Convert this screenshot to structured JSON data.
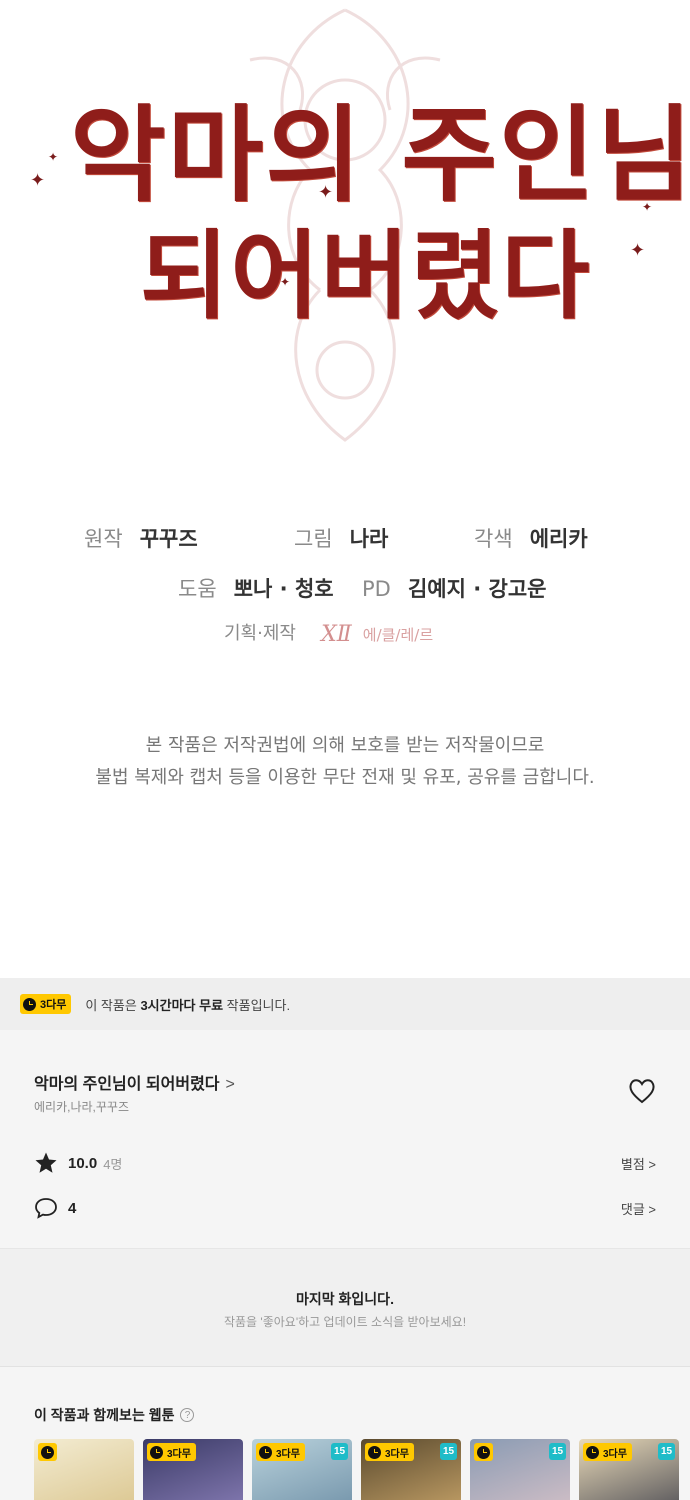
{
  "cover": {
    "title_line1": "악마의 주인님이",
    "title_line2": "되어버렸다"
  },
  "credits": {
    "original_label": "원작",
    "original_value": "꾸꾸즈",
    "art_label": "그림",
    "art_value": "나라",
    "adapt_label": "각색",
    "adapt_value": "에리카",
    "help_label": "도움",
    "help_value": "뽀나 · 청호",
    "pd_label": "PD",
    "pd_value": "김예지 · 강고운",
    "produce_label": "기획·제작",
    "studio_mark": "XⅡ",
    "studio_name": "에/클/레/르"
  },
  "copyright": {
    "line1": "본 작품은 저작권법에 의해 보호를 받는 저작물이므로",
    "line2": "불법 복제와 캡처 등을 이용한 무단 전재 및 유포, 공유를 금합니다."
  },
  "free_banner": {
    "badge": "3다무",
    "text_prefix": "이 작품은",
    "text_bold": "3시간마다 무료",
    "text_suffix": "작품입니다."
  },
  "work": {
    "title": "악마의 주인님이 되어버렸다",
    "title_chevron": ">",
    "authors": "에리카,나라,꾸꾸즈",
    "rating": "10.0",
    "rating_count": "4명",
    "rating_link": "별점 >",
    "comments": "4",
    "comments_link": "댓글 >"
  },
  "last_episode": {
    "title": "마지막 화입니다.",
    "subtitle": "작품을 '좋아요'하고 업데이트 소식을 받아보세요!"
  },
  "recommendations": {
    "heading": "이 작품과 함께보는 웹툰",
    "help": "?",
    "items": [
      {
        "badge": "",
        "age": "",
        "color1": "#f3ecd2",
        "color2": "#d9c38a"
      },
      {
        "badge": "3다무",
        "age": "",
        "color1": "#3a3a66",
        "color2": "#8a7fb8"
      },
      {
        "badge": "3다무",
        "age": "15",
        "color1": "#b9d2dc",
        "color2": "#6e8fa6"
      },
      {
        "badge": "3다무",
        "age": "15",
        "color1": "#5a4a2e",
        "color2": "#c9a56a"
      },
      {
        "badge": "",
        "age": "15",
        "color1": "#8a9bb3",
        "color2": "#d7c2c8"
      },
      {
        "badge": "3다무",
        "age": "15",
        "color1": "#e8d9b8",
        "color2": "#4a4a52"
      }
    ]
  },
  "colors": {
    "title_red": "#8f1d1a",
    "badge_yellow": "#ffc800",
    "age_teal": "#1fbcc8"
  }
}
